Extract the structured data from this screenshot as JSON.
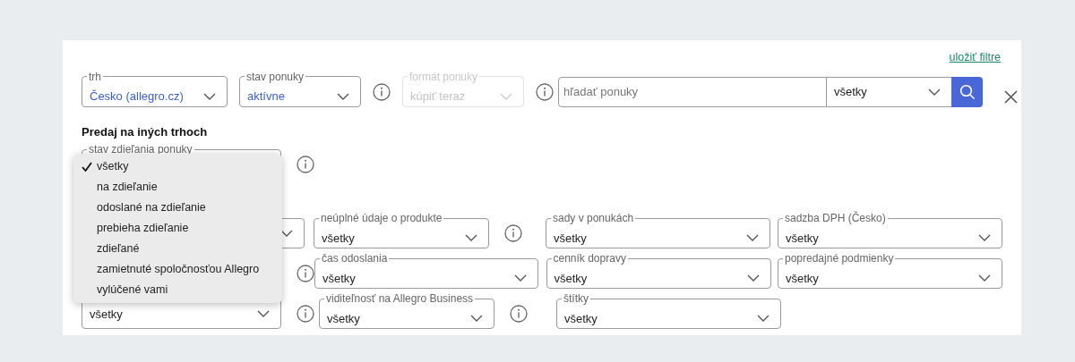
{
  "save_filters_link": "uložiť filtre",
  "top_filters": [
    {
      "label": "trh",
      "value": "Česko (allegro.cz)",
      "modified": true,
      "disabled": false,
      "info": false
    },
    {
      "label": "stav ponuky",
      "value": "aktívne",
      "modified": true,
      "disabled": false,
      "info": true
    },
    {
      "label": "formát ponuky",
      "value": "kúpiť teraz",
      "modified": false,
      "disabled": true,
      "info": true
    }
  ],
  "search": {
    "placeholder": "hľadať ponuky",
    "scope": "všetky"
  },
  "section_title": "Predaj na iných trhoch",
  "sharing_filter": {
    "label": "stav zdieľania ponuky",
    "info": true
  },
  "sharing_menu": [
    {
      "label": "všetky",
      "selected": true
    },
    {
      "label": "na zdieľanie",
      "selected": false
    },
    {
      "label": "odoslané na zdieľanie",
      "selected": false
    },
    {
      "label": "prebieha zdieľanie",
      "selected": false
    },
    {
      "label": "zdieľané",
      "selected": false
    },
    {
      "label": "zamietnuté spoločnosťou Allegro",
      "selected": false
    },
    {
      "label": "vylúčené vami",
      "selected": false
    }
  ],
  "filter_rows": [
    [
      {
        "info": false
      },
      {
        "label": "neúplné údaje o produkte",
        "value": "všetky",
        "info": true
      },
      {
        "label": "sady v ponukách",
        "value": "všetky",
        "info": false
      },
      {
        "label": "sadzba DPH (Česko)",
        "value": "všetky",
        "info": false
      }
    ],
    [
      {
        "info": true
      },
      {
        "label": "čas odoslania",
        "value": "všetky",
        "info": false
      },
      {
        "label": "cenník dopravy",
        "value": "všetky",
        "info": false
      },
      {
        "label": "popredajné podmienky",
        "value": "všetky",
        "info": false
      }
    ],
    [
      {
        "value": "všetky",
        "info": true
      },
      {
        "label": "viditeľnosť na Allegro Business",
        "value": "všetky",
        "info": true
      },
      {
        "label": "štítky",
        "value": "všetky",
        "info": false
      }
    ]
  ]
}
